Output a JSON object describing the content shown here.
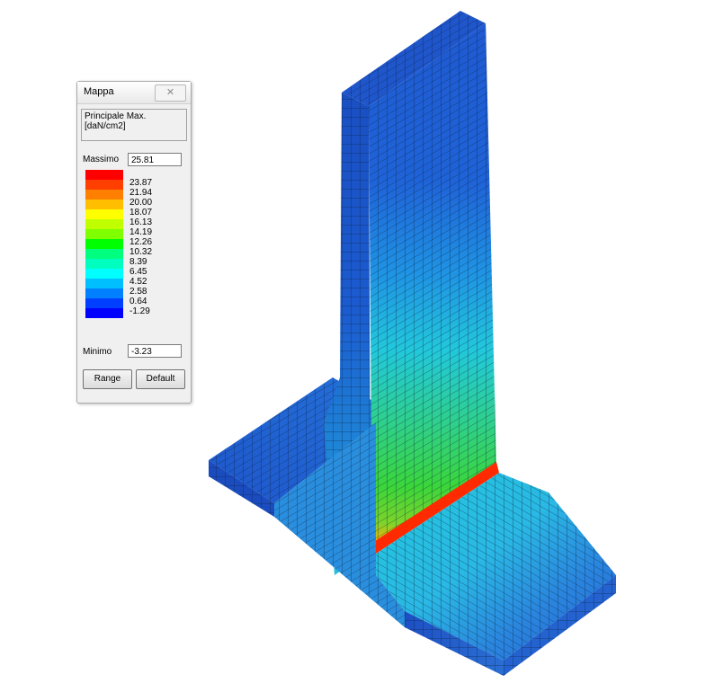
{
  "legend_window": {
    "title": "Mappa",
    "quantity_line1": "Principale Max.",
    "quantity_line2": "[daN/cm2]",
    "max_label": "Massimo",
    "max_value": "25.81",
    "min_label": "Minimo",
    "min_value": "-3.23",
    "scale_values": [
      "23.87",
      "21.94",
      "20.00",
      "18.07",
      "16.13",
      "14.19",
      "12.26",
      "10.32",
      "8.39",
      "6.45",
      "4.52",
      "2.58",
      "0.64",
      "-1.29"
    ],
    "scale_colors": [
      "#ff0000",
      "#ff3f00",
      "#ff7f00",
      "#ffbf00",
      "#ffff00",
      "#bfff00",
      "#7fff00",
      "#00ff00",
      "#00ff7f",
      "#00ffbf",
      "#00ffff",
      "#00bfff",
      "#007fff",
      "#003fff",
      "#0000ff"
    ],
    "range_button": "Range",
    "default_button": "Default",
    "close_icon": "close-icon"
  },
  "model_colors": {
    "stem_top": "#1e5fd4",
    "stem_middle": "#20c4dc",
    "stem_base": "#3ad63a",
    "junction": "#ff3c00",
    "slab": "#2a78d8",
    "slab_light": "#3ec8e0",
    "mesh_line": "#0a1f3a"
  }
}
